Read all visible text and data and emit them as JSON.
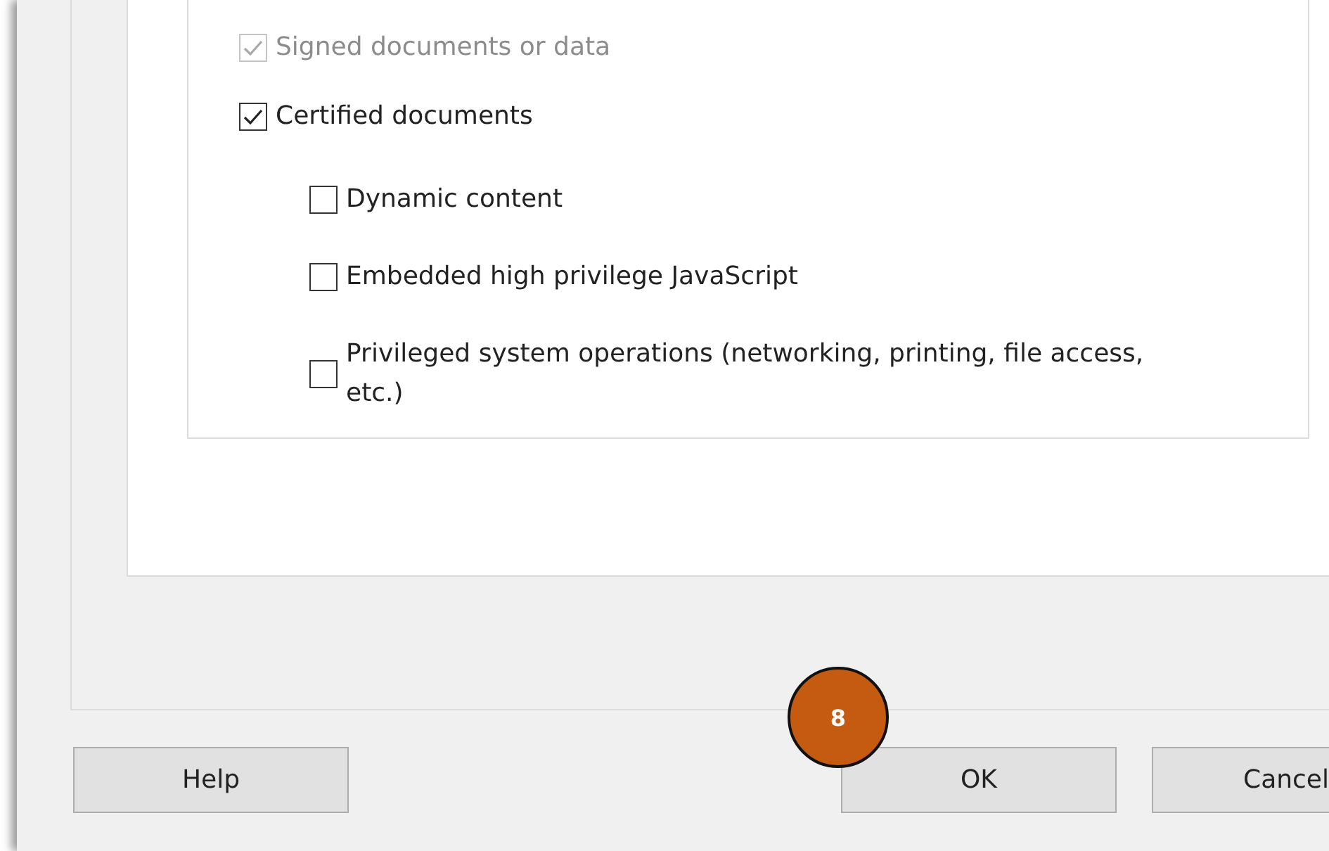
{
  "options": [
    {
      "label": "Signed documents or data",
      "checked": true,
      "disabled": true
    },
    {
      "label": "Certified documents",
      "checked": true,
      "disabled": false,
      "children": [
        {
          "label": "Dynamic content",
          "checked": false,
          "disabled": false
        },
        {
          "label": "Embedded high privilege JavaScript",
          "checked": false,
          "disabled": false
        },
        {
          "label": "Privileged system operations (networking, printing, file access, etc.)",
          "checked": false,
          "disabled": false
        }
      ]
    }
  ],
  "buttons": [
    {
      "label": "Help"
    },
    {
      "label": "OK"
    },
    {
      "label": "Cancel"
    }
  ],
  "callout": {
    "label": "8"
  }
}
